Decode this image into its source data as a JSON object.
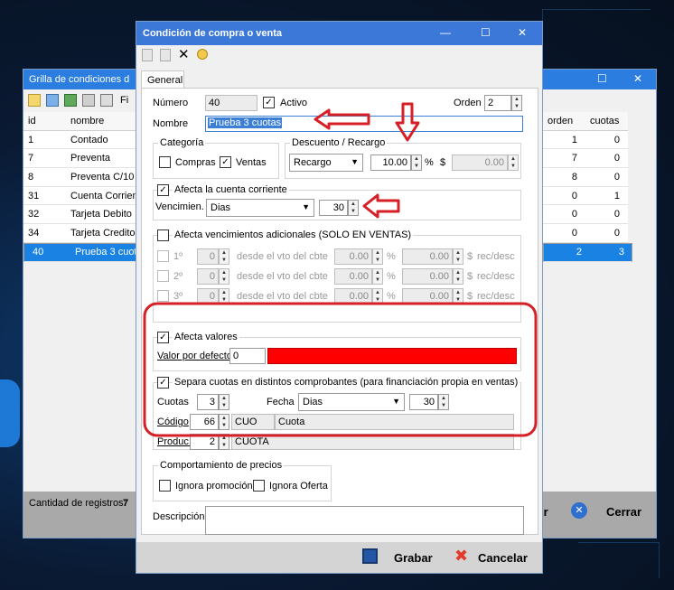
{
  "back_window": {
    "title": "Grilla de condiciones d",
    "toolbar_fi": "Fi",
    "columns": {
      "id": "id",
      "nombre": "nombre",
      "orden": "orden",
      "cuotas": "cuotas"
    },
    "rows": [
      {
        "id": "1",
        "nombre": "Contado",
        "orden": "1",
        "cuotas": "0"
      },
      {
        "id": "7",
        "nombre": "Preventa",
        "orden": "7",
        "cuotas": "0"
      },
      {
        "id": "8",
        "nombre": "Preventa C/10",
        "orden": "8",
        "cuotas": "0"
      },
      {
        "id": "31",
        "nombre": "Cuenta Corriente",
        "orden": "0",
        "cuotas": "1"
      },
      {
        "id": "32",
        "nombre": "Tarjeta Debito",
        "orden": "0",
        "cuotas": "0"
      },
      {
        "id": "34",
        "nombre": "Tarjeta Credito",
        "orden": "0",
        "cuotas": "0"
      },
      {
        "id": "40",
        "nombre": "Prueba 3 cuotas",
        "orden": "2",
        "cuotas": "3"
      }
    ],
    "count_label": "Cantidad de registros:",
    "count_value": "7",
    "partial_label": "ir",
    "close_label": "Cerrar"
  },
  "dialog": {
    "title": "Condición de compra o venta",
    "tab": "General",
    "numero_label": "Número",
    "numero_value": "40",
    "activo_label": "Activo",
    "orden_label": "Orden",
    "orden_value": "2",
    "nombre_label": "Nombre",
    "nombre_value": "Prueba 3 cuotas",
    "categoria_label": "Categoría",
    "compras_label": "Compras",
    "ventas_label": "Ventas",
    "descuento_label": "Descuento / Recargo",
    "recargo_option": "Recargo",
    "recargo_value": "10.00",
    "percent": "%",
    "dollar": "$",
    "monto_value": "0.00",
    "afecta_cc_label": "Afecta la cuenta corriente",
    "vencimien_label": "Vencimien.",
    "dias_option": "Dias",
    "dias_value": "30",
    "afecta_venc_label": "Afecta vencimientos adicionales (SOLO EN VENTAS)",
    "venc_rows": [
      {
        "n": "1º",
        "days": "0",
        "desde": "desde el vto del cbte",
        "pct": "0.00",
        "amt": "0.00",
        "rec": "rec/desc"
      },
      {
        "n": "2º",
        "days": "0",
        "desde": "desde el vto del cbte",
        "pct": "0.00",
        "amt": "0.00",
        "rec": "rec/desc"
      },
      {
        "n": "3º",
        "days": "0",
        "desde": "desde el vto del cbte",
        "pct": "0.00",
        "amt": "0.00",
        "rec": "rec/desc"
      }
    ],
    "afecta_valores_label": "Afecta valores",
    "valor_defecto_label": "Valor por defecto",
    "valor_defecto_value": "0",
    "separa_label": "Separa cuotas en distintos comprobantes (para financiación propia en ventas)",
    "cuotas_label": "Cuotas",
    "cuotas_value": "3",
    "fecha_label": "Fecha",
    "fecha_option": "Dias",
    "fecha_value": "30",
    "codigo_label": "Código",
    "codigo_value": "66",
    "codigo_code": "CUO",
    "codigo_desc": "Cuota",
    "produc_label": "Produc.",
    "produc_value": "2",
    "produc_desc": "CUOTA",
    "comportamiento_label": "Comportamiento de precios",
    "ignora_promo_label": "Ignora promoción",
    "ignora_oferta_label": "Ignora Oferta",
    "descripcion_label": "Descripción",
    "grabar_label": "Grabar",
    "cancelar_label": "Cancelar"
  },
  "colors": {
    "annotation": "#d61f26",
    "selection": "#1a82e2",
    "title_bar": "#3c78d8",
    "swatch": "#ff0000"
  }
}
